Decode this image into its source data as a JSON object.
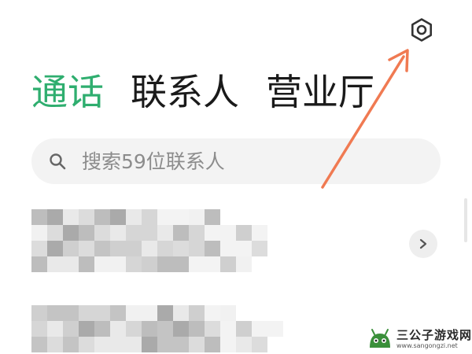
{
  "header": {
    "settings_icon": "gear-hexagon-icon"
  },
  "tabs": [
    {
      "label": "通话",
      "active": true
    },
    {
      "label": "联系人",
      "active": false
    },
    {
      "label": "营业厅",
      "active": false
    }
  ],
  "search": {
    "placeholder": "搜索59位联系人",
    "icon": "search-icon"
  },
  "contacts": {
    "row_chevron_icon": "chevron-right-icon"
  },
  "watermark": {
    "title": "三公子游戏网",
    "url": "www.sangongzi.net"
  },
  "colors": {
    "active_tab": "#2fae6f",
    "annotation_arrow": "#f07a52",
    "search_bg": "#f3f3f3"
  }
}
